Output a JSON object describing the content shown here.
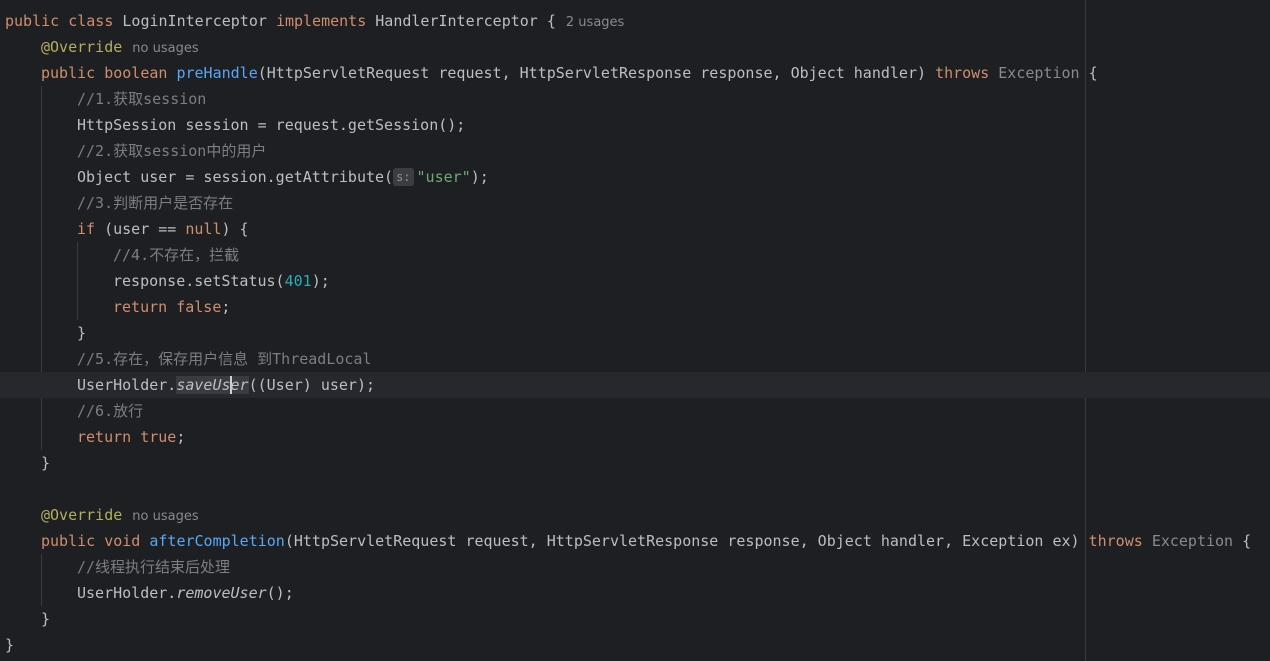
{
  "editor": {
    "usages": {
      "class": "2 usages",
      "pre_override": "no usages",
      "after_override": "no usages"
    },
    "code": {
      "public": "public",
      "class_kw": "class",
      "class_name": "LoginInterceptor",
      "implements": "implements",
      "interface_name": "HandlerInterceptor",
      "open_brace": " {",
      "annotation": "@Override",
      "boolean": "boolean",
      "void": "void",
      "pre_method": "preHandle",
      "pre_params": "(HttpServletRequest request, HttpServletResponse response, Object handler) ",
      "throws": "throws",
      "exception": "Exception",
      "comment1": "//1.获取session",
      "line_session": "HttpSession session = request.getSession();",
      "comment2": "//2.获取session中的用户",
      "line_user_prefix": "Object user = session.getAttribute(",
      "param_hint": "s:",
      "user_string": "\"user\"",
      "line_user_suffix": ");",
      "comment3": "//3.判断用户是否存在",
      "if_kw": "if",
      "if_cond_a": " (user == ",
      "null_kw": "null",
      "if_cond_b": ") {",
      "comment4": "//4.不存在，拦截",
      "set_status_prefix": "response.setStatus(",
      "status_code": "401",
      "set_status_suffix": ");",
      "return_kw": "return",
      "false_kw": "false",
      "true_kw": "true",
      "semicolon": ";",
      "close_brace": "}",
      "comment5": "//5.存在，保存用户信息 到ThreadLocal",
      "holder_prefix": "UserHolder.",
      "save_method_a": "saveUs",
      "save_method_b": "er",
      "save_suffix": "((User) user);",
      "comment6": "//6.放行",
      "after_method": "afterCompletion",
      "after_params": "(HttpServletRequest request, HttpServletResponse response, Object handler, Exception ex) ",
      "comment7": "//线程执行结束后处理",
      "remove_method": "removeUser",
      "remove_suffix": "();"
    }
  }
}
